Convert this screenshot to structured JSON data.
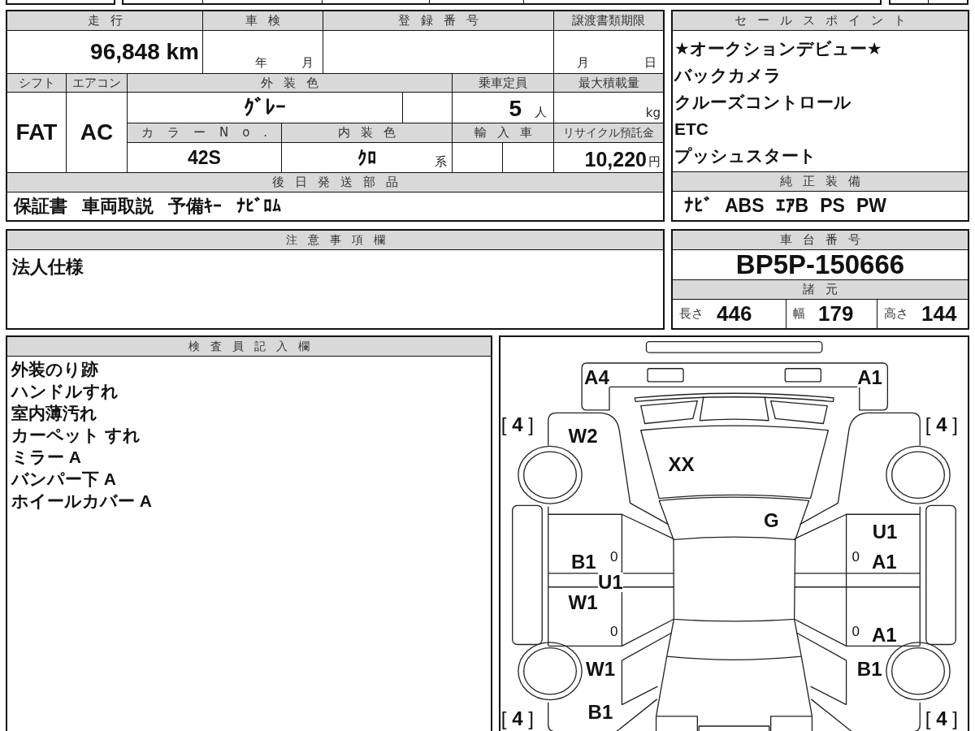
{
  "top_table": {
    "mileage": {
      "label": "走行",
      "value": "96,848 km"
    },
    "inspection": {
      "label": "車検",
      "year_unit": "年",
      "month_unit": "月"
    },
    "registration": {
      "label": "登録番号"
    },
    "transfer_deadline": {
      "label": "譲渡書類期限",
      "month_unit": "月",
      "day_unit": "日"
    },
    "shift": {
      "label": "シフト",
      "value": "FAT"
    },
    "air_conditioner": {
      "label": "エアコン",
      "value": "AC"
    },
    "exterior_color": {
      "label": "外装色",
      "value": "ｸﾞﾚｰ"
    },
    "capacity": {
      "label": "乗車定員",
      "value": "5",
      "unit": "人"
    },
    "max_load": {
      "label": "最大積載量",
      "unit": "kg"
    },
    "color_number": {
      "label": "カラーNo.",
      "value": "42S"
    },
    "interior_color": {
      "label": "内装色",
      "value": "ｸﾛ",
      "suffix": "系"
    },
    "imported": {
      "label": "輸入車"
    },
    "recycle_deposit": {
      "label": "リサイクル預託金",
      "value": "10,220",
      "unit": "円"
    },
    "parts_to_ship": {
      "label": "後日発送部品",
      "items": [
        "保証書",
        "車両取説",
        "予備ｷｰ",
        "ﾅﾋﾞﾛﾑ"
      ]
    }
  },
  "sales_points": {
    "title": "セールスポイント",
    "items": [
      "★オークションデビュー★",
      "バックカメラ",
      "クルーズコントロール",
      "ETC",
      "プッシュスタート"
    ]
  },
  "genuine_equipment": {
    "title": "純正装備",
    "items": [
      "ﾅﾋﾞ",
      "ABS",
      "ｴｱB",
      "PS",
      "PW"
    ]
  },
  "notes": {
    "title": "注意事項欄",
    "text": "法人仕様"
  },
  "chassis": {
    "title": "車台番号",
    "value": "BP5P-150666"
  },
  "specs": {
    "title": "諸元",
    "items": [
      {
        "label": "長さ",
        "value": "446"
      },
      {
        "label": "幅",
        "value": "179"
      },
      {
        "label": "高さ",
        "value": "144"
      }
    ]
  },
  "inspector_notes": {
    "title": "検査員記入欄",
    "lines": [
      "外装のり跡",
      "ハンドルすれ",
      "室内薄汚れ",
      "カーペット すれ",
      "ミラー A",
      "バンパー下 A",
      "ホイールカバー A"
    ]
  },
  "damage_diagram": {
    "marks": [
      {
        "kind": "code",
        "text": "A4"
      },
      {
        "kind": "code",
        "text": "A1"
      },
      {
        "kind": "tread",
        "text": "[ **4** ]"
      },
      {
        "kind": "tread",
        "text": "[ **4** ]"
      },
      {
        "kind": "code",
        "text": "W2"
      },
      {
        "kind": "code",
        "text": "XX"
      },
      {
        "kind": "code",
        "text": "G"
      },
      {
        "kind": "code",
        "text": "U1"
      },
      {
        "kind": "code",
        "text": "B1"
      },
      {
        "kind": "count",
        "text": "0"
      },
      {
        "kind": "count",
        "text": "0"
      },
      {
        "kind": "code",
        "text": "A1"
      },
      {
        "kind": "code",
        "text": "U1"
      },
      {
        "kind": "code",
        "text": "W1"
      },
      {
        "kind": "count",
        "text": "0"
      },
      {
        "kind": "count",
        "text": "0"
      },
      {
        "kind": "code",
        "text": "A1"
      },
      {
        "kind": "code",
        "text": "W1"
      },
      {
        "kind": "code",
        "text": "B1"
      },
      {
        "kind": "code",
        "text": "B1"
      },
      {
        "kind": "tread",
        "text": "[ **4** ]"
      },
      {
        "kind": "tread",
        "text": "[ **4** ]"
      }
    ]
  }
}
